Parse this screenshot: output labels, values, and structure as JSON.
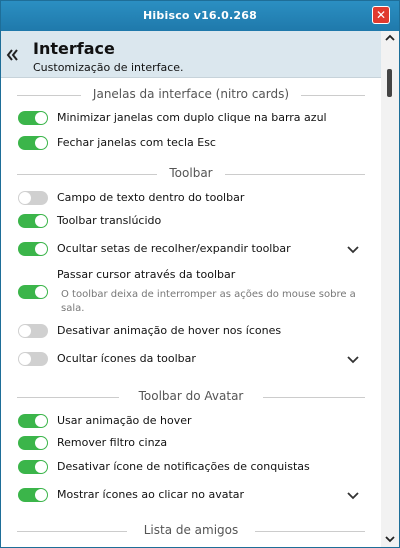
{
  "window": {
    "title": "Hibisco v16.0.268"
  },
  "header": {
    "title": "Interface",
    "subtitle": "Customização de interface."
  },
  "sections": [
    {
      "title": "Janelas da interface (nitro cards)",
      "rows": [
        {
          "label": "Minimizar janelas com duplo clique na barra azul",
          "on": true
        },
        {
          "label": "Fechar janelas com tecla Esc",
          "on": true
        }
      ]
    },
    {
      "title": "Toolbar",
      "rows": [
        {
          "label": "Campo de texto dentro do toolbar",
          "on": false
        },
        {
          "label": "Toolbar translúcido",
          "on": true
        },
        {
          "label": "Ocultar setas de recolher/expandir toolbar",
          "on": true,
          "expand": true
        },
        {
          "label": "Passar cursor através da toolbar",
          "on": true,
          "description": "O toolbar deixa de interromper as ações do mouse sobre a sala."
        },
        {
          "label": "Desativar animação de hover nos ícones",
          "on": false
        },
        {
          "label": "Ocultar ícones da toolbar",
          "on": false,
          "expand": true
        }
      ]
    },
    {
      "title": "Toolbar do Avatar",
      "rows": [
        {
          "label": "Usar animação de hover",
          "on": true
        },
        {
          "label": "Remover filtro cinza",
          "on": true
        },
        {
          "label": "Desativar ícone de notificações de conquistas",
          "on": true
        },
        {
          "label": "Mostrar ícones ao clicar no avatar",
          "on": true,
          "expand": true
        }
      ]
    },
    {
      "title": "Lista de amigos",
      "rows": []
    }
  ],
  "colors": {
    "titlebar": "#1f79ab",
    "toggle_on": "#3bb54a",
    "toggle_off": "#d0d0d0",
    "close": "#e03a2e"
  }
}
